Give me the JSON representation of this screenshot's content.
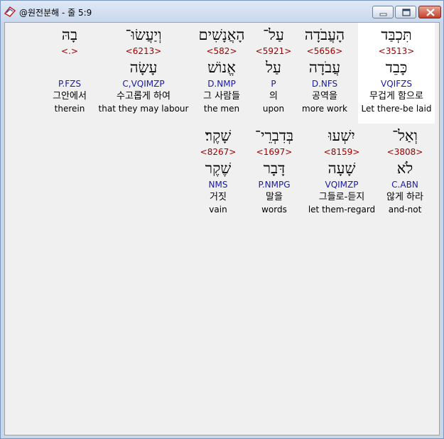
{
  "window": {
    "title": "@원전분해 - 줄 5:9"
  },
  "rows": [
    {
      "words": [
        {
          "heb": "תִּכְבַּד",
          "strong": "<3513>",
          "lex": "כָּבֵד",
          "morph": "VQIFZS",
          "kor": "무겁게 함으로",
          "eng": "Let there-be laid",
          "selected": true
        },
        {
          "heb": "הָעֲבֹדָה",
          "strong": "<5656>",
          "lex": "עֲבֹדָה",
          "morph": "D.NFS",
          "kor": "공역을",
          "eng": "more work"
        },
        {
          "heb": "עַל־",
          "strong": "<5921>",
          "lex": "עַל",
          "morph": "P",
          "kor": "의",
          "eng": "upon"
        },
        {
          "heb": "הָאֲנָשִׁים",
          "strong": "<582>",
          "lex": "אֱנוֹשׁ",
          "morph": "D.NMP",
          "kor": "그 사람들",
          "eng": "the men"
        },
        {
          "heb": "וְיַעֲשׂוּ־",
          "strong": "<6213>",
          "lex": "עָשָׂה",
          "morph": "C,VQIMZP",
          "kor": "수고롭게 하여",
          "eng": "that they may labour"
        },
        {
          "heb": "בָהּ",
          "strong": "<.>",
          "lex": "",
          "morph": "P.FZS",
          "kor": "그안에서",
          "eng": "therein"
        }
      ]
    },
    {
      "words": [
        {
          "heb": "וְאַל־",
          "strong": "<3808>",
          "lex": "לֹא",
          "morph": "C.ABN",
          "kor": "않게 하라",
          "eng": "and-not"
        },
        {
          "heb": "יִשְׁעוּ",
          "strong": "<8159>",
          "lex": "שָׁעָה",
          "morph": "VQIMZP",
          "kor": "그들로-듣지",
          "eng": "let them-regard"
        },
        {
          "heb": "בְּדִבְרֵי־",
          "strong": "<1697>",
          "lex": "דָּבָר",
          "morph": "P.NMPG",
          "kor": "말을",
          "eng": "words"
        },
        {
          "heb": "שָׁקֶר׃",
          "strong": "<8267>",
          "lex": "שֶׁקֶר",
          "morph": "NMS",
          "kor": "거짓",
          "eng": "vain"
        }
      ]
    }
  ],
  "colors": {
    "strong": "#a00000",
    "morph": "#1a1aa6",
    "background": "#f0f0f0",
    "selected": "#ffffff"
  }
}
